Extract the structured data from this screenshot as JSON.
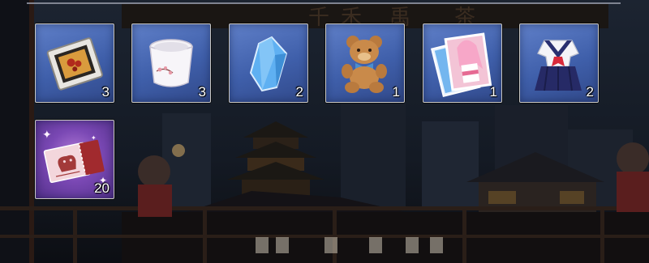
{
  "inventory": {
    "items": [
      {
        "icon": "framed-painting-icon",
        "count": "3"
      },
      {
        "icon": "porcelain-cup-icon",
        "count": "3"
      },
      {
        "icon": "blue-crystal-icon",
        "count": "2"
      },
      {
        "icon": "teddy-bear-icon",
        "count": "1"
      },
      {
        "icon": "character-photo-cards-icon",
        "count": "1"
      },
      {
        "icon": "sailor-uniform-icon",
        "count": "2"
      },
      {
        "icon": "ticket-icon",
        "count": "20"
      }
    ]
  },
  "colors": {
    "slot_blue": "#4a68b4",
    "slot_purple": "#7a48b4",
    "slot_border": "#c9c7c2",
    "count_text": "#ffffff"
  }
}
